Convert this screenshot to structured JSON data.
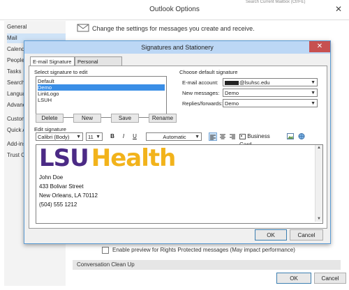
{
  "outer": {
    "title": "Outlook Options",
    "search_peek": "Search Current Mailbox (Ctrl+E)",
    "close_label": "✕",
    "nav": [
      "General",
      "Mail",
      "Calendar",
      "People",
      "Tasks",
      "Search",
      "Language",
      "Advanced",
      "Customize Ribbon",
      "Quick Access Toolbar",
      "Add-ins",
      "Trust Center"
    ],
    "header_text": "Change the settings for messages you create and receive.",
    "rights_protected": "Enable preview for Rights Protected messages (May impact performance)",
    "conversation_cleanup": "Conversation Clean Up",
    "ok": "OK",
    "cancel": "Cancel"
  },
  "dialog": {
    "title": "Signatures and Stationery",
    "close_label": "✕",
    "tabs": [
      "E-mail Signature",
      "Personal Stationery"
    ],
    "select_label": "Select signature to edit",
    "signatures": [
      "Default",
      "Demo",
      "LinkLogo",
      "LSUH"
    ],
    "buttons": {
      "delete": "Delete",
      "new": "New",
      "save": "Save",
      "rename": "Rename",
      "ok": "OK",
      "cancel": "Cancel"
    },
    "choose_default": "Choose default signature",
    "email_account_label": "E-mail account:",
    "email_account_value": "@lsuhsc.edu",
    "new_messages_label": "New messages:",
    "new_messages_value": "Demo",
    "replies_label": "Replies/forwards:",
    "replies_value": "Demo",
    "edit_label": "Edit signature",
    "font": "Calibri (Body)",
    "size": "11",
    "bold": "B",
    "italic": "I",
    "underline": "U",
    "color": "Automatic",
    "business_card": "Business Card",
    "logo_part1": "LSU",
    "logo_part2": "Health",
    "sig_lines": [
      "John Doe",
      "433 Bolivar Street",
      "New Orleans, LA 70112",
      "(504) 555 1212"
    ]
  },
  "colors": {
    "lsu_purple": "#4b2a85",
    "lsu_gold": "#f2b31b",
    "selection": "#3a8ee6"
  }
}
